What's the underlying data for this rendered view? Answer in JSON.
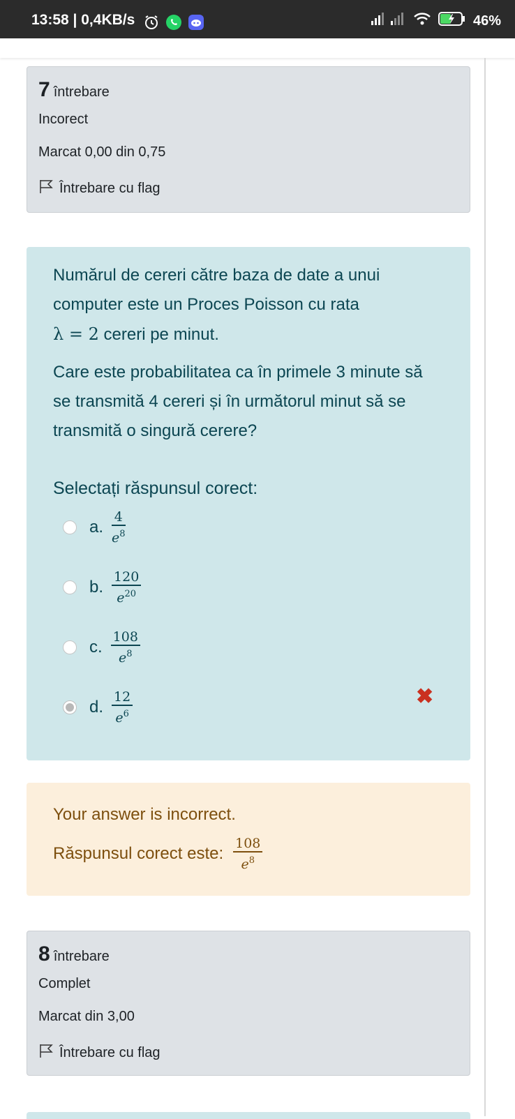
{
  "status_bar": {
    "time": "13:58 | 0,4KB/s",
    "battery": "46%",
    "icons": [
      "alarm-icon",
      "whatsapp-icon",
      "discord-icon",
      "signal-icon",
      "wifi-icon",
      "battery-icon"
    ]
  },
  "question7": {
    "number": "7",
    "label": "întrebare",
    "state": "Incorect",
    "mark": "Marcat 0,00 din 0,75",
    "flag_label": "Întrebare cu flag",
    "text_part1": "Numărul de cereri către baza de date a unui computer este un Proces Poisson cu rata",
    "math_lambda": "λ = 2",
    "text_part2": "cereri pe minut.",
    "text2": "Care este probabilitatea ca în primele 3 minute să se transmită 4 cereri și în următorul minut să se transmită o singură cerere?",
    "prompt": "Selectați răspunsul corect:",
    "options": [
      {
        "letter": "a.",
        "num": "4",
        "den_base": "e",
        "den_exp": "8"
      },
      {
        "letter": "b.",
        "num": "120",
        "den_base": "e",
        "den_exp": "20"
      },
      {
        "letter": "c.",
        "num": "108",
        "den_base": "e",
        "den_exp": "8"
      },
      {
        "letter": "d.",
        "num": "12",
        "den_base": "e",
        "den_exp": "6"
      }
    ],
    "selected": "d.",
    "wrong_mark": "✖",
    "feedback": {
      "line1": "Your answer is incorrect.",
      "line2": "Răspunsul corect este:",
      "num": "108",
      "den_base": "e",
      "den_exp": "8"
    }
  },
  "question8": {
    "number": "8",
    "label": "întrebare",
    "state": "Complet",
    "mark": "Marcat din 3,00",
    "flag_label": "Întrebare cu flag"
  },
  "colors": {
    "info_bg": "#dee2e6",
    "content_bg": "#cfe7ea",
    "content_text": "#0c4652",
    "feedback_bg": "#fcefdc",
    "feedback_text": "#7d4f0e",
    "wrong": "#ca3120"
  }
}
